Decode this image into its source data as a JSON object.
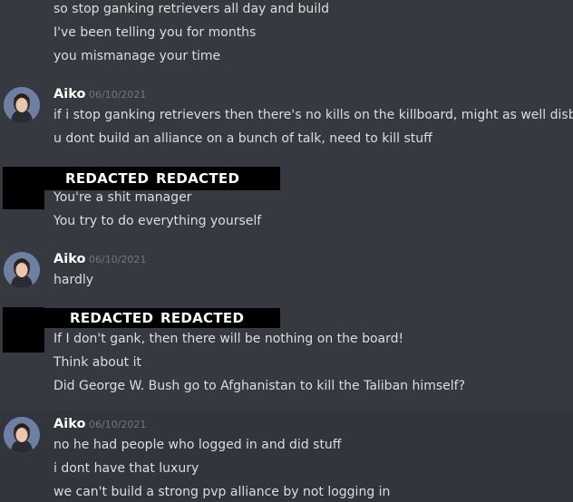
{
  "messages": {
    "top": [
      "so stop ganking retrievers all day and build",
      "I've been telling you for months",
      "you mismanage your time"
    ],
    "group1": {
      "author": "Aiko",
      "timestamp": "06/10/2021",
      "lines": [
        "if i stop ganking retrievers then there's no kills on the killboard, might as well disband",
        "u dont build an alliance on a bunch of talk, need to kill stuff"
      ]
    },
    "group2": {
      "redacted_1": "REDACTED",
      "redacted_2": "REDACTED",
      "lines": [
        "You're a shit manager",
        "You try to do everything yourself"
      ]
    },
    "group3": {
      "author": "Aiko",
      "timestamp": "06/10/2021",
      "lines": [
        "hardly"
      ]
    },
    "group4": {
      "redacted_1": "REDACTED",
      "redacted_2": "REDACTED",
      "lines": [
        "If I don't gank, then there will be nothing on the board!",
        "Think about it",
        "Did George W. Bush go to Afghanistan to kill the Taliban himself?"
      ]
    },
    "group5": {
      "author": "Aiko",
      "timestamp": "06/10/2021",
      "lines": [
        "no he had people who logged in and did stuff",
        "i dont have that luxury",
        "we can't build a strong pvp alliance by not logging in"
      ]
    }
  },
  "colors": {
    "background": "#36393f",
    "text": "#dcddde",
    "author": "#ffffff",
    "timestamp": "#72767d"
  }
}
